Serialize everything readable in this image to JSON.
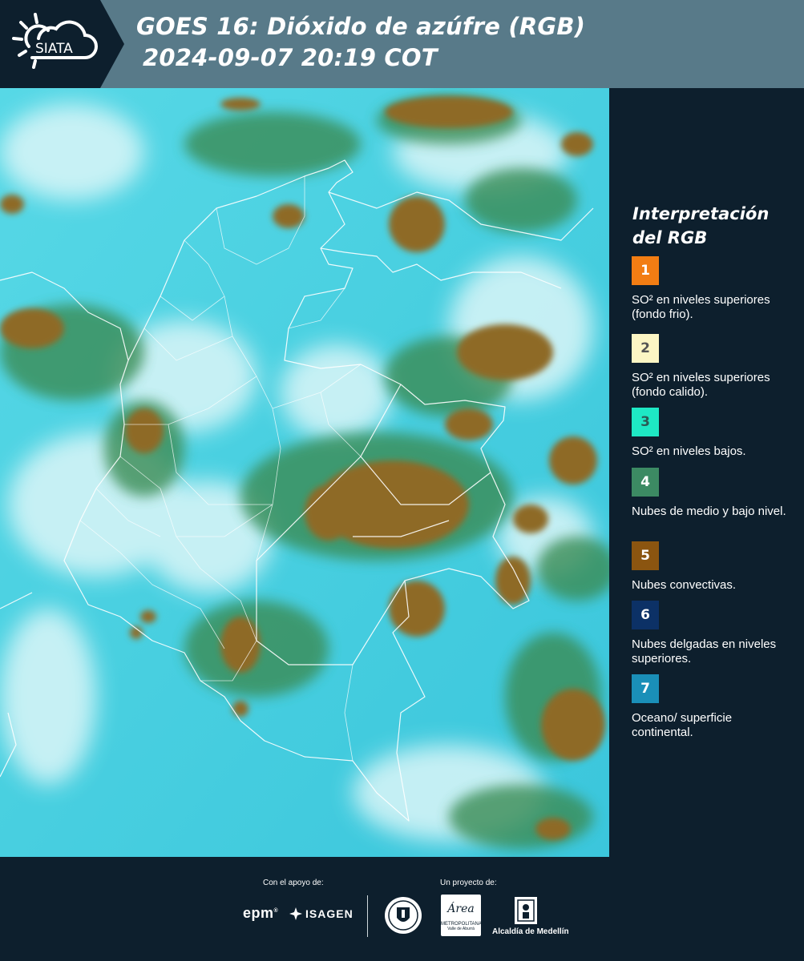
{
  "header": {
    "logo_text": "SIATA",
    "title_line1": "GOES 16: Dióxido de azúfre (RGB)",
    "title_line2": "2024-09-07 20:19 COT"
  },
  "legend": {
    "title": "Interpretación del RGB",
    "items": [
      {
        "number": "1",
        "label": "SO² en niveles superiores (fondo frio).",
        "color": "#f27d13",
        "text_color": "#ffffff"
      },
      {
        "number": "2",
        "label": "SO² en niveles superiores (fondo calido).",
        "color": "#fcf6c4",
        "text_color": "#555555"
      },
      {
        "number": "3",
        "label": "SO² en niveles bajos.",
        "color": "#1ee8c4",
        "text_color": "#2b5b55"
      },
      {
        "number": "4",
        "label": "Nubes de medio y bajo nivel.",
        "color": "#3c8a63",
        "text_color": "#ffffff"
      },
      {
        "number": "5",
        "label": "Nubes convectivas.",
        "color": "#8b5510",
        "text_color": "#ffffff"
      },
      {
        "number": "6",
        "label": "Nubes delgadas en niveles superiores.",
        "color": "#0c3166",
        "text_color": "#ffffff"
      },
      {
        "number": "7",
        "label": "Oceano/ superficie continental.",
        "color": "#1a8fb8",
        "text_color": "#ffffff"
      }
    ]
  },
  "footer": {
    "support_label": "Con el apoyo de:",
    "project_label": "Un proyecto de:",
    "sponsors": [
      "epm",
      "ISAGEN"
    ],
    "partners": [
      "Área Metropolitana Valle de Aburrá",
      "Alcaldía de Medellín"
    ],
    "area_name": "Área",
    "area_subtitle": "METROPOLITANA",
    "area_subtitle2": "Valle de Aburrá",
    "alcaldia": "Alcaldía de Medellín"
  }
}
